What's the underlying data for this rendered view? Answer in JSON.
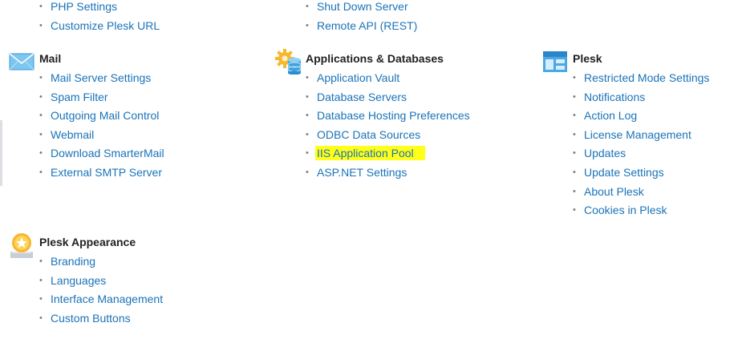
{
  "colors": {
    "link": "#1a73b8",
    "highlight": "#ffff1a",
    "heading": "#222222"
  },
  "top_col1": {
    "items": [
      "PHP Settings",
      "Customize Plesk URL"
    ]
  },
  "top_col2": {
    "items": [
      "Shut Down Server",
      "Remote API (REST)"
    ]
  },
  "mail": {
    "title": "Mail",
    "icon": "envelope-icon",
    "items": [
      "Mail Server Settings",
      "Spam Filter",
      "Outgoing Mail Control",
      "Webmail",
      "Download SmarterMail",
      "External SMTP Server"
    ]
  },
  "apps": {
    "title": "Applications & Databases",
    "icon": "gear-database-icon",
    "items": [
      "Application Vault",
      "Database Servers",
      "Database Hosting Preferences",
      "ODBC Data Sources",
      "IIS Application Pool",
      "ASP.NET Settings"
    ],
    "highlighted": "IIS Application Pool"
  },
  "plesk": {
    "title": "Plesk",
    "icon": "plesk-window-icon",
    "items": [
      "Restricted Mode Settings",
      "Notifications",
      "Action Log",
      "License Management",
      "Updates",
      "Update Settings",
      "About Plesk",
      "Cookies in Plesk"
    ]
  },
  "appearance": {
    "title": "Plesk Appearance",
    "icon": "appearance-badge-icon",
    "items": [
      "Branding",
      "Languages",
      "Interface Management",
      "Custom Buttons"
    ]
  }
}
